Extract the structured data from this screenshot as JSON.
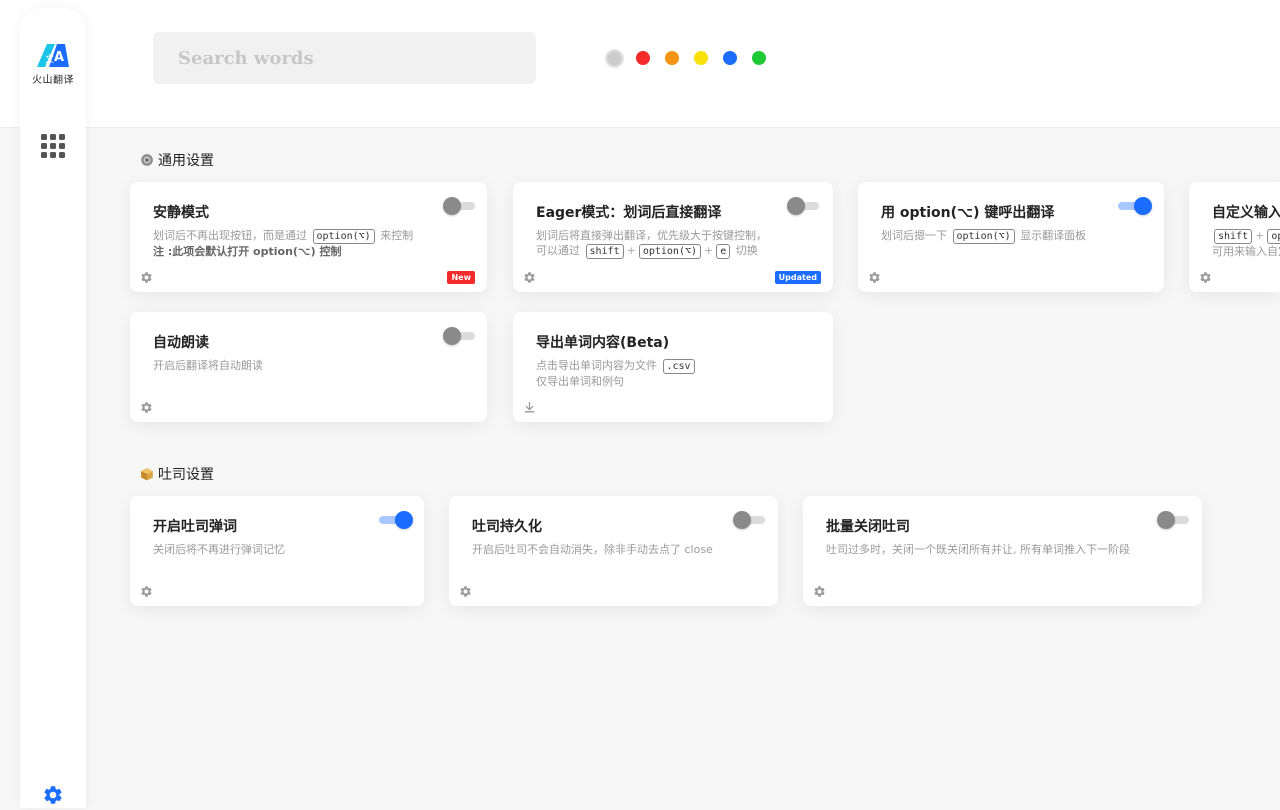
{
  "app": {
    "logo_text": "火山翻译",
    "brand_color": "#1a6dff"
  },
  "search": {
    "placeholder": "Search words",
    "value": ""
  },
  "color_dots": [
    {
      "color": "#cccccc",
      "selected": true
    },
    {
      "color": "#f52a2a",
      "selected": false
    },
    {
      "color": "#f39413",
      "selected": false
    },
    {
      "color": "#fbe10c",
      "selected": false
    },
    {
      "color": "#1a6dff",
      "selected": false
    },
    {
      "color": "#20c936",
      "selected": false
    }
  ],
  "sections": {
    "general": {
      "icon": "gear-emoji-icon",
      "title": "通用设置",
      "cards": {
        "quiet": {
          "title": "安静模式",
          "desc_a1": "划词后不再出现按钮，而是通过",
          "desc_a_kbd": "option(⌥)",
          "desc_a2": "来控制",
          "desc_b": "注 :此项会默认打开 option(⌥) 控制",
          "toggle_on": false,
          "badge": "New",
          "badge_color": "#f52a2a"
        },
        "eager": {
          "title": "Eager模式：划词后直接翻译",
          "desc_a": "划词后将直接弹出翻译，优先级大于按键控制，",
          "desc_b1": "可以通过",
          "desc_b_kbd1": "shift",
          "desc_b_plus1": "+",
          "desc_b_kbd2": "option(⌥)",
          "desc_b_plus2": "+",
          "desc_b_kbd3": "e",
          "desc_b2": "切换",
          "toggle_on": false,
          "badge": "Updated",
          "badge_color": "#1a6dff"
        },
        "option_key": {
          "title": "用 option(⌥) 键呼出翻译",
          "desc_a1": "划词后摁一下",
          "desc_a_kbd": "option(⌥)",
          "desc_a2": "显示翻译面板",
          "toggle_on": true
        },
        "custom_input": {
          "title": "自定义输入",
          "desc_a_kbd1": "shift",
          "desc_a_plus": "+",
          "desc_a_kbd2": "op",
          "desc_b": "可用来输入自定"
        },
        "auto_read": {
          "title": "自动朗读",
          "desc_a": "开启后翻译将自动朗读",
          "toggle_on": false
        },
        "export": {
          "title": "导出单词内容(Beta)",
          "desc_a1": "点击导出单词内容为文件",
          "desc_a_kbd": ".csv",
          "desc_b": "仅导出单词和例句"
        }
      }
    },
    "toast": {
      "icon": "box-emoji-icon",
      "title": "吐司设置",
      "cards": {
        "popup": {
          "title": "开启吐司弹词",
          "desc_a": "关闭后将不再进行弹词记忆",
          "toggle_on": true
        },
        "persist": {
          "title": "吐司持久化",
          "desc_a": "开启后吐司不会自动消失，除非手动去点了 close",
          "toggle_on": false
        },
        "batch_close": {
          "title": "批量关闭吐司",
          "desc_a": "吐司过多时，关闭一个既关闭所有并让, 所有单词推入下一阶段",
          "toggle_on": false
        }
      }
    }
  }
}
